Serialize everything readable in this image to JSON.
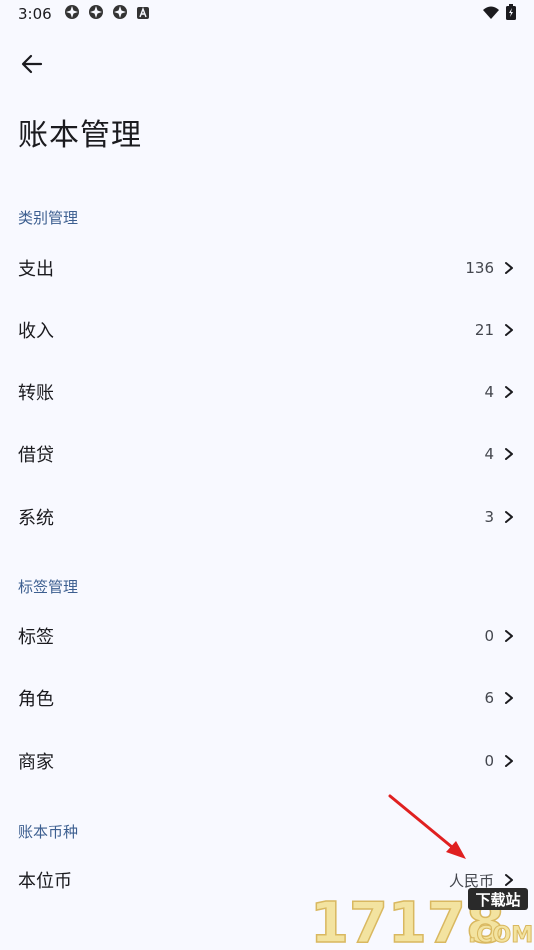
{
  "status": {
    "time": "3:06"
  },
  "page": {
    "title": "账本管理"
  },
  "sections": {
    "category": {
      "header": "类别管理",
      "items": [
        {
          "label": "支出",
          "value": "136"
        },
        {
          "label": "收入",
          "value": "21"
        },
        {
          "label": "转账",
          "value": "4"
        },
        {
          "label": "借贷",
          "value": "4"
        },
        {
          "label": "系统",
          "value": "3"
        }
      ]
    },
    "tags": {
      "header": "标签管理",
      "items": [
        {
          "label": "标签",
          "value": "0"
        },
        {
          "label": "角色",
          "value": "6"
        },
        {
          "label": "商家",
          "value": "0"
        }
      ]
    },
    "currency": {
      "header": "账本币种",
      "items": [
        {
          "label": "本位币",
          "value": "人民币"
        }
      ]
    }
  },
  "watermark": {
    "text": "17178",
    "badge": "下载站",
    "domain": ".COM"
  },
  "colors": {
    "accent": "#3d5f90",
    "background": "#f8f9ff",
    "annotation": "#e02020"
  }
}
